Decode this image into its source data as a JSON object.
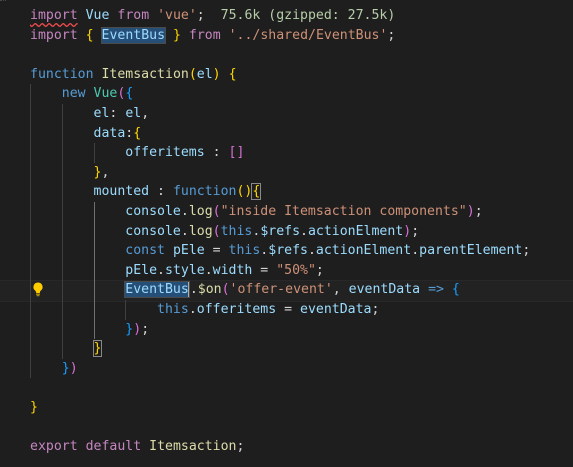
{
  "editor": {
    "lines": [
      {
        "tokens": [
          [
            "import",
            "kw2 squiggle"
          ],
          [
            " ",
            "plain"
          ],
          [
            "Vue",
            "var"
          ],
          [
            " ",
            "plain"
          ],
          [
            "from",
            "kw2"
          ],
          [
            " ",
            "plain"
          ],
          [
            "'vue'",
            "str"
          ],
          [
            ";",
            "plain"
          ],
          [
            "  75.6k (gzipped: 27.5k)",
            "hint"
          ]
        ]
      },
      {
        "tokens": [
          [
            "import",
            "kw2"
          ],
          [
            " ",
            "plain"
          ],
          [
            "{",
            "b1"
          ],
          [
            " ",
            "plain"
          ],
          [
            "EventBus",
            "var hl-word"
          ],
          [
            " ",
            "plain"
          ],
          [
            "}",
            "b1"
          ],
          [
            " ",
            "plain"
          ],
          [
            "from",
            "kw2"
          ],
          [
            " ",
            "plain"
          ],
          [
            "'../shared/EventBus'",
            "str"
          ],
          [
            ";",
            "plain"
          ]
        ]
      },
      {
        "tokens": []
      },
      {
        "tokens": [
          [
            "function",
            "kw"
          ],
          [
            " ",
            "plain"
          ],
          [
            "Itemsaction",
            "fn"
          ],
          [
            "(",
            "b1"
          ],
          [
            "el",
            "var"
          ],
          [
            ")",
            "b1"
          ],
          [
            " ",
            "plain"
          ],
          [
            "{",
            "b1"
          ]
        ]
      },
      {
        "tokens": [
          [
            "    ",
            "plain"
          ],
          [
            "new",
            "kw"
          ],
          [
            " ",
            "plain"
          ],
          [
            "Vue",
            "cls"
          ],
          [
            "(",
            "b2"
          ],
          [
            "{",
            "b3"
          ]
        ]
      },
      {
        "tokens": [
          [
            "        ",
            "plain"
          ],
          [
            "el",
            "var"
          ],
          [
            ": ",
            "plain"
          ],
          [
            "el",
            "var"
          ],
          [
            ",",
            "plain"
          ]
        ]
      },
      {
        "tokens": [
          [
            "        ",
            "plain"
          ],
          [
            "data",
            "var"
          ],
          [
            ":",
            "plain"
          ],
          [
            "{",
            "b1"
          ]
        ]
      },
      {
        "tokens": [
          [
            "            ",
            "plain"
          ],
          [
            "offeritems",
            "var"
          ],
          [
            " : ",
            "plain"
          ],
          [
            "[",
            "b2"
          ],
          [
            "]",
            "b2"
          ]
        ]
      },
      {
        "tokens": [
          [
            "        ",
            "plain"
          ],
          [
            "}",
            "b1"
          ],
          [
            ",",
            "plain"
          ]
        ]
      },
      {
        "tokens": [
          [
            "        ",
            "plain"
          ],
          [
            "mounted",
            "var"
          ],
          [
            " : ",
            "plain"
          ],
          [
            "function",
            "kw"
          ],
          [
            "(",
            "b1"
          ],
          [
            ")",
            "b1"
          ],
          [
            "{",
            "b1 bracket-box"
          ]
        ]
      },
      {
        "tokens": [
          [
            "            ",
            "plain"
          ],
          [
            "console",
            "var"
          ],
          [
            ".",
            "plain"
          ],
          [
            "log",
            "fn"
          ],
          [
            "(",
            "b2"
          ],
          [
            "\"inside Itemsaction components\"",
            "str"
          ],
          [
            ")",
            "b2"
          ],
          [
            ";",
            "plain"
          ]
        ]
      },
      {
        "tokens": [
          [
            "            ",
            "plain"
          ],
          [
            "console",
            "var"
          ],
          [
            ".",
            "plain"
          ],
          [
            "log",
            "fn"
          ],
          [
            "(",
            "b2"
          ],
          [
            "this",
            "kw"
          ],
          [
            ".",
            "plain"
          ],
          [
            "$refs",
            "var"
          ],
          [
            ".",
            "plain"
          ],
          [
            "actionElment",
            "var"
          ],
          [
            ")",
            "b2"
          ],
          [
            ";",
            "plain"
          ]
        ]
      },
      {
        "tokens": [
          [
            "            ",
            "plain"
          ],
          [
            "const",
            "kw"
          ],
          [
            " ",
            "plain"
          ],
          [
            "pEle",
            "var"
          ],
          [
            " = ",
            "plain"
          ],
          [
            "this",
            "kw"
          ],
          [
            ".",
            "plain"
          ],
          [
            "$refs",
            "var"
          ],
          [
            ".",
            "plain"
          ],
          [
            "actionElment",
            "var"
          ],
          [
            ".",
            "plain"
          ],
          [
            "parentElement",
            "var"
          ],
          [
            ";",
            "plain"
          ]
        ]
      },
      {
        "tokens": [
          [
            "            ",
            "plain"
          ],
          [
            "pEle",
            "var"
          ],
          [
            ".",
            "plain"
          ],
          [
            "style",
            "var"
          ],
          [
            ".",
            "plain"
          ],
          [
            "width",
            "var"
          ],
          [
            " = ",
            "plain"
          ],
          [
            "\"50%\"",
            "str"
          ],
          [
            ";",
            "plain"
          ]
        ]
      },
      {
        "tokens": [
          [
            "            ",
            "plain"
          ],
          [
            "EventBus",
            "var hl-word"
          ],
          [
            ".",
            "plain"
          ],
          [
            "$on",
            "fn"
          ],
          [
            "(",
            "b2"
          ],
          [
            "'offer-event'",
            "str"
          ],
          [
            ", ",
            "plain"
          ],
          [
            "eventData",
            "var"
          ],
          [
            " ",
            "plain"
          ],
          [
            "=>",
            "kw"
          ],
          [
            " ",
            "plain"
          ],
          [
            "{",
            "b3"
          ]
        ]
      },
      {
        "tokens": [
          [
            "                ",
            "plain"
          ],
          [
            "this",
            "kw"
          ],
          [
            ".",
            "plain"
          ],
          [
            "offeritems",
            "var"
          ],
          [
            " = ",
            "plain"
          ],
          [
            "eventData",
            "var"
          ],
          [
            ";",
            "plain"
          ]
        ]
      },
      {
        "tokens": [
          [
            "            ",
            "plain"
          ],
          [
            "}",
            "b3"
          ],
          [
            ")",
            "b2"
          ],
          [
            ";",
            "plain"
          ]
        ]
      },
      {
        "tokens": [
          [
            "        ",
            "plain"
          ],
          [
            "}",
            "b1 bracket-box"
          ]
        ]
      },
      {
        "tokens": [
          [
            "    ",
            "plain"
          ],
          [
            "}",
            "b3"
          ],
          [
            ")",
            "b2"
          ]
        ]
      },
      {
        "tokens": []
      },
      {
        "tokens": [
          [
            "}",
            "b1"
          ]
        ]
      },
      {
        "tokens": []
      },
      {
        "tokens": [
          [
            "export",
            "kw2"
          ],
          [
            " ",
            "plain"
          ],
          [
            "default",
            "kw2"
          ],
          [
            " ",
            "plain"
          ],
          [
            "Itemsaction",
            "fn"
          ],
          [
            ";",
            "plain"
          ]
        ]
      }
    ],
    "lightbulb_icon": "lightbulb-icon",
    "active_line": 14
  }
}
